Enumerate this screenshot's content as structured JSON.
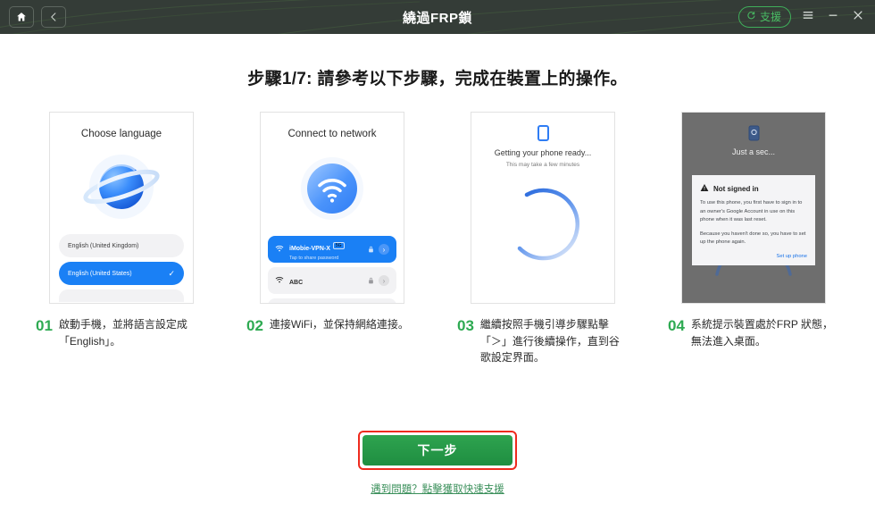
{
  "titlebar": {
    "title": "繞過FRP鎖",
    "home_icon": "home-icon",
    "back_icon": "chevron-left-icon",
    "support_label": "支援",
    "support_icon": "refresh-circle-icon",
    "menu_icon": "hamburger-menu-icon",
    "minimize_icon": "minimize-icon",
    "close_icon": "close-icon",
    "bg_color": "#343c37",
    "accent_color": "#49bd63"
  },
  "heading": "步驟1/7: 請參考以下步驟，完成在裝置上的操作。",
  "cards": [
    {
      "id": "choose-language",
      "title": "Choose language",
      "graphic": "globe-planet-icon",
      "options": [
        {
          "label": "English (United Kingdom)",
          "selected": false,
          "check": ""
        },
        {
          "label": "English (United States)",
          "selected": true,
          "check": "✓"
        }
      ]
    },
    {
      "id": "connect-to-network",
      "title": "Connect to network",
      "graphic": "wifi-circle-icon",
      "networks": [
        {
          "name": "iMobie-VPN-X",
          "badge": "5G",
          "sub": "Tap to share password",
          "selected": true
        },
        {
          "name": "ABC",
          "badge": "",
          "sub": "",
          "selected": false
        }
      ]
    },
    {
      "id": "getting-phone-ready",
      "top_icon": "phone-icon",
      "title": "Getting your phone ready...",
      "subtitle": "This may take a few minutes",
      "graphic": "loading-spinner-icon"
    },
    {
      "id": "not-signed-in",
      "top_icon": "phone-lock-icon",
      "title": "Just a sec...",
      "dialog": {
        "warn_icon": "warning-triangle-icon",
        "heading": "Not signed in",
        "paragraph1": "To use this phone, you first have to sign in to an owner's Google Account in use on this phone when it was last reset.",
        "paragraph2": "Because you haven't done so, you have to set up the phone again.",
        "action": "Set up phone"
      }
    }
  ],
  "steps": [
    {
      "num": "01",
      "text": "啟動手機，並將語言設定成「English」。"
    },
    {
      "num": "02",
      "text": "連接WiFi，並保持網絡連接。"
    },
    {
      "num": "03",
      "text": "繼續按照手機引導步驟點擊「＞」進行後續操作，直到谷歌設定界面。"
    },
    {
      "num": "04",
      "text": "系統提示裝置處於FRP 狀態，無法進入桌面。"
    }
  ],
  "footer": {
    "next_label": "下一步",
    "help_link": "遇到問題？點擊獲取快速支援",
    "highlight_color": "#ef2b1e",
    "button_color": "#2ea34f"
  }
}
